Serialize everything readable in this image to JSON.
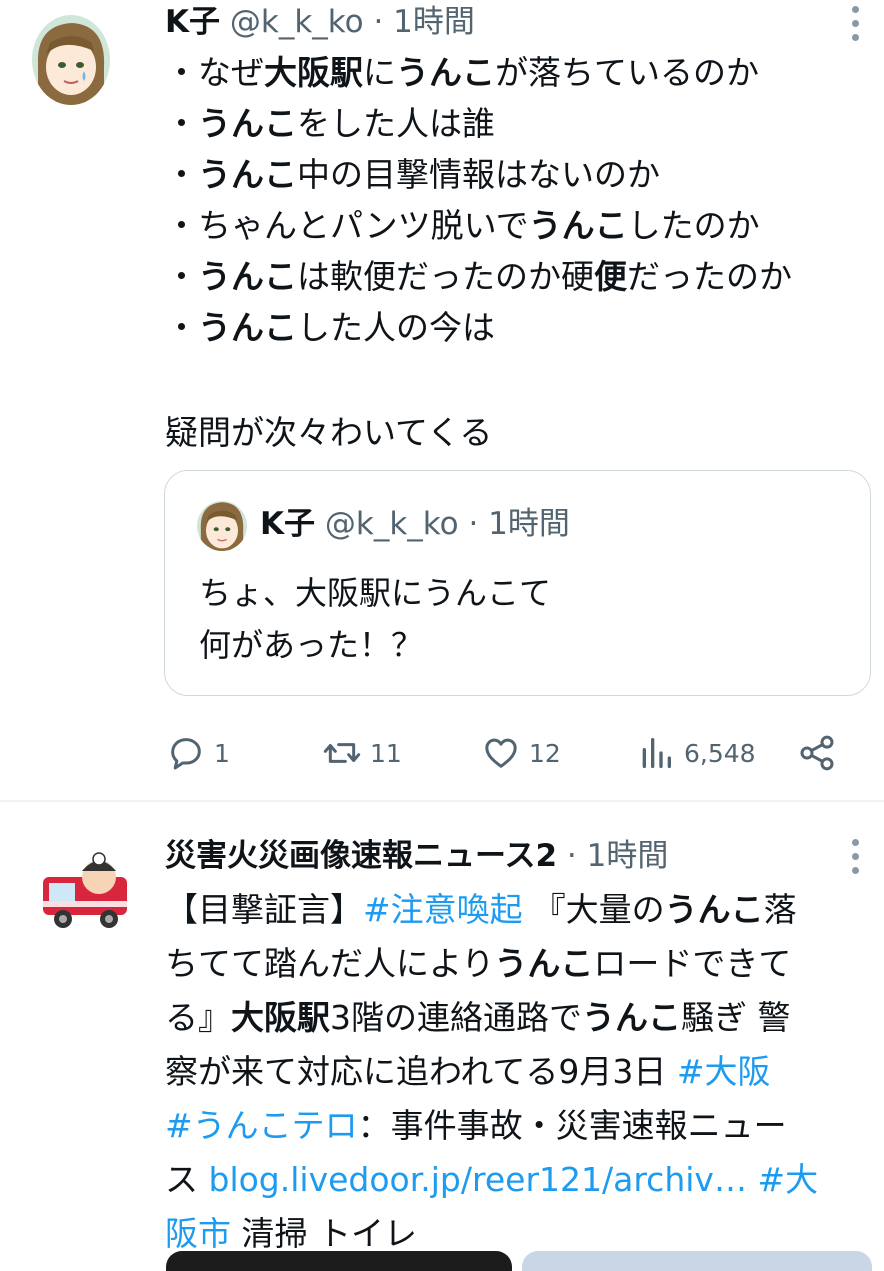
{
  "tweet1": {
    "name": "K子",
    "handle": "@k_k_ko",
    "sep": " · ",
    "time": "1時間",
    "lines": [
      [
        "・なぜ",
        "大阪駅",
        "に",
        "うんこ",
        "が落ちているのか"
      ],
      [
        "・",
        "うんこ",
        "をした人は誰"
      ],
      [
        "・",
        "うんこ",
        "中の目撃情報はないのか"
      ],
      [
        "・ちゃんとパンツ脱いで",
        "うんこ",
        "したのか"
      ],
      [
        "・",
        "うんこ",
        "は軟便だったのか硬",
        "便",
        "だったのか"
      ],
      [
        "・",
        "うんこ",
        "した人の今は"
      ]
    ],
    "closing": "疑問が次々わいてくる",
    "quote": {
      "name": "K子",
      "handle": "@k_k_ko",
      "sep": " · ",
      "time": "1時間",
      "line1": "ちょ、大阪駅にうんこて",
      "line2": "何があった！？"
    },
    "actions": {
      "replies": "1",
      "retweets": "11",
      "likes": "12",
      "views": "6,548"
    }
  },
  "tweet2": {
    "name": "災害火災画像速報ニュース2",
    "sep": " · ",
    "time": "1時間",
    "l1": [
      "【目撃証言】",
      "#注意喚起",
      "『大量の",
      "うんこ",
      "落"
    ],
    "l2": [
      "ちてて踏んだ人により",
      "うんこ",
      "ロードできて"
    ],
    "l3": [
      "る』",
      "大阪駅",
      "3階の連絡通路で",
      "うんこ",
      "騒ぎ 警"
    ],
    "l4": [
      "察が来て対応に追われてる9月3日 ",
      "#大阪"
    ],
    "l5": [
      "#うんこテロ",
      "：事件事故・災害速報ニュー"
    ],
    "l6": [
      "ス ",
      "blog.livedoor.jp/reer121/archiv…",
      " ",
      "#大"
    ],
    "l7": [
      "阪市",
      " 清掃 トイレ"
    ]
  },
  "colors": {
    "text": "#0f1419",
    "secondary": "#536471",
    "link": "#1d9bf0",
    "border": "#cfd9de"
  },
  "icons": [
    "more-icon",
    "reply-icon",
    "retweet-icon",
    "like-icon",
    "views-icon",
    "share-icon"
  ]
}
